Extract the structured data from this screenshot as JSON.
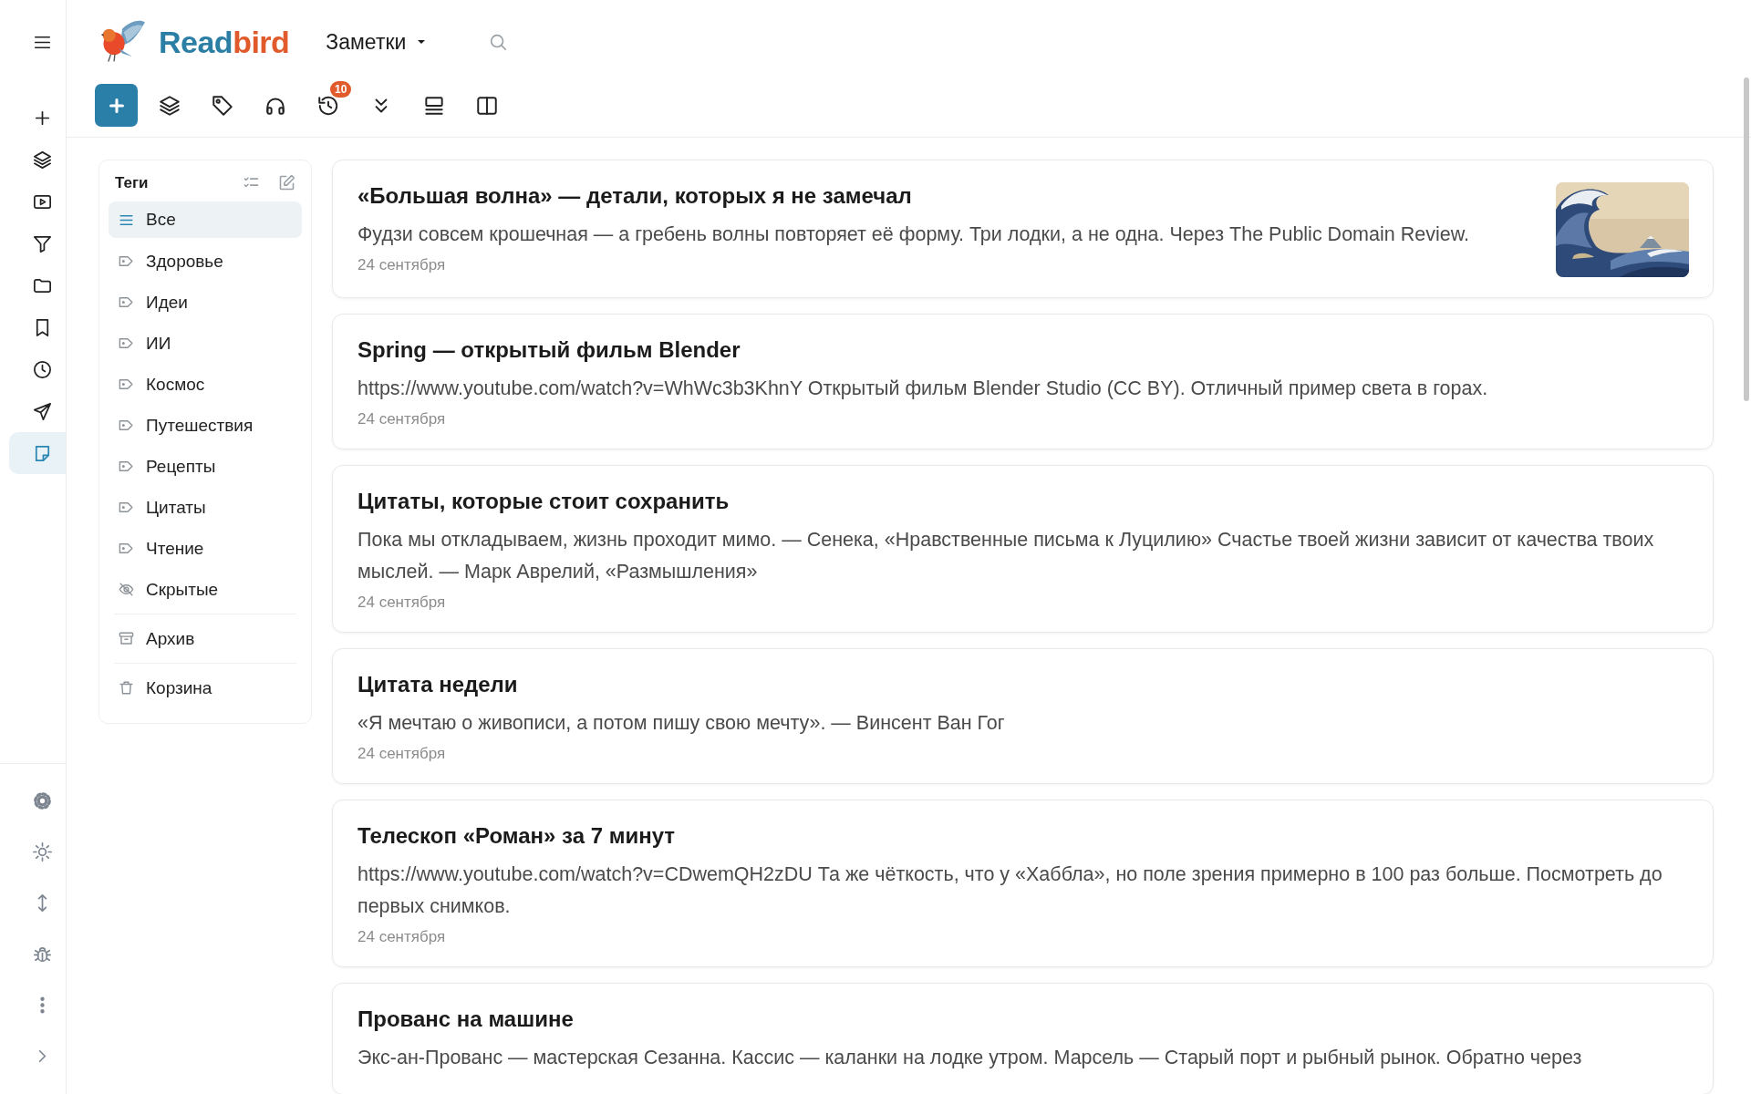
{
  "rail": {
    "top": [
      {
        "kind": "menu",
        "selected": false
      }
    ],
    "items": [
      {
        "kind": "add",
        "selected": false
      },
      {
        "kind": "layers",
        "selected": false
      },
      {
        "kind": "video",
        "selected": false
      },
      {
        "kind": "filter",
        "selected": false
      },
      {
        "kind": "folder",
        "selected": false
      },
      {
        "kind": "bookmark",
        "selected": false
      },
      {
        "kind": "history",
        "selected": false
      },
      {
        "kind": "send",
        "selected": false
      },
      {
        "kind": "notes",
        "selected": true
      }
    ],
    "bottom": [
      {
        "kind": "settings"
      },
      {
        "kind": "theme"
      },
      {
        "kind": "sort"
      },
      {
        "kind": "debug"
      },
      {
        "kind": "more"
      },
      {
        "kind": "expand"
      }
    ]
  },
  "header": {
    "brand_first": "Read",
    "brand_second": "bird",
    "view": "Заметки"
  },
  "toolbar": [
    {
      "kind": "add"
    },
    {
      "kind": "layers"
    },
    {
      "kind": "tags"
    },
    {
      "kind": "audio"
    },
    {
      "kind": "history",
      "badge": "10"
    },
    {
      "kind": "collapse"
    },
    {
      "kind": "list"
    },
    {
      "kind": "split"
    }
  ],
  "tags": {
    "title": "Теги",
    "sections": [
      [
        {
          "kind": "all",
          "label": "Все",
          "selected": true
        },
        {
          "kind": "tag",
          "label": "Здоровье",
          "selected": false
        },
        {
          "kind": "tag",
          "label": "Идеи",
          "selected": false
        },
        {
          "kind": "tag",
          "label": "ИИ",
          "selected": false
        },
        {
          "kind": "tag",
          "label": "Космос",
          "selected": false
        },
        {
          "kind": "tag",
          "label": "Путешествия",
          "selected": false
        },
        {
          "kind": "tag",
          "label": "Рецепты",
          "selected": false
        },
        {
          "kind": "tag",
          "label": "Цитаты",
          "selected": false
        },
        {
          "kind": "tag",
          "label": "Чтение",
          "selected": false
        },
        {
          "kind": "hidden",
          "label": "Скрытые",
          "selected": false
        }
      ],
      [
        {
          "kind": "archive",
          "label": "Архив",
          "selected": false
        }
      ],
      [
        {
          "kind": "trash",
          "label": "Корзина",
          "selected": false
        }
      ]
    ]
  },
  "notes": [
    {
      "title": "«Большая волна» — детали, которых я не замечал",
      "body": "Фудзи совсем крошечная — а гребень волны повторяет её форму. Три лодки, а не одна. Через The Public Domain Review.",
      "date": "24 сентября"
    },
    {
      "title": "Spring — открытый фильм Blender",
      "body": "https://www.youtube.com/watch?v=WhWc3b3KhnY Открытый фильм Blender Studio (CC BY). Отличный пример света в горах.",
      "date": "24 сентября"
    },
    {
      "title": "Цитаты, которые стоит сохранить",
      "body": "Пока мы откладываем, жизнь проходит мимо. — Сенека, «Нравственные письма к Луцилию» Счастье твоей жизни зависит от качества твоих мыслей. — Марк Аврелий, «Размышления»",
      "date": "24 сентября"
    },
    {
      "title": "Цитата недели",
      "body": "«Я мечтаю о живописи, а потом пишу свою мечту». — Винсент Ван Гог",
      "date": "24 сентября"
    },
    {
      "title": "Телескоп «Роман» за 7 минут",
      "body": "https://www.youtube.com/watch?v=CDwemQH2zDU Та же чёткость, что у «Хаббла», но поле зрения примерно в 100 раз больше. Посмотреть до первых снимков.",
      "date": "24 сентября"
    },
    {
      "title": "Прованс на машине",
      "body": "Экс-ан-Прованс — мастерская Сезанна. Кассис — каланки на лодке утром. Марсель — Старый порт и рыбный рынок. Обратно через"
    }
  ]
}
